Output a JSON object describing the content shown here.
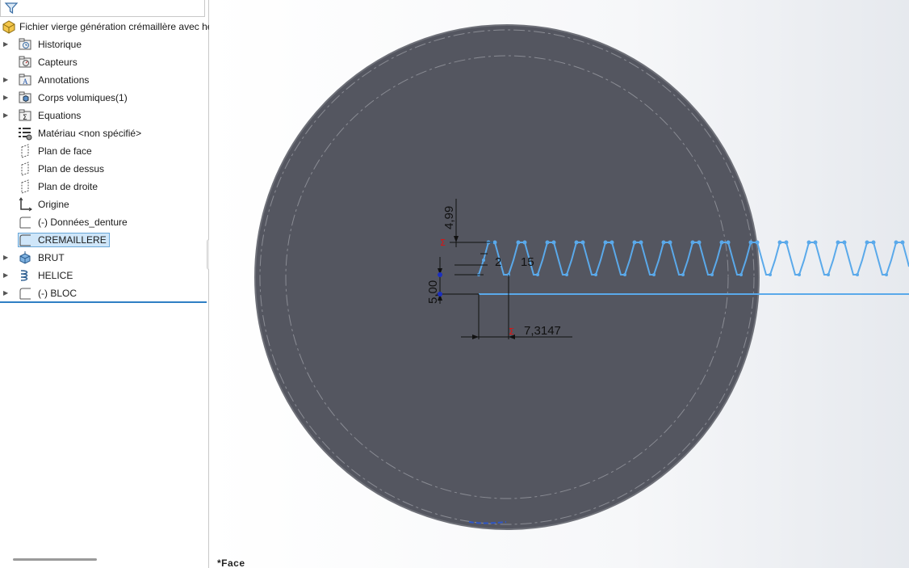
{
  "feature_tree": {
    "root_label": "Fichier vierge génération crémaillère avec hé",
    "items": [
      {
        "label": "Historique",
        "icon": "history-folder-icon",
        "expandable": true
      },
      {
        "label": "Capteurs",
        "icon": "sensors-icon",
        "expandable": false
      },
      {
        "label": "Annotations",
        "icon": "annotations-icon",
        "expandable": true
      },
      {
        "label": "Corps volumiques(1)",
        "icon": "solid-bodies-icon",
        "expandable": true
      },
      {
        "label": "Equations",
        "icon": "equations-icon",
        "expandable": true
      },
      {
        "label": "Matériau <non spécifié>",
        "icon": "material-icon",
        "expandable": false
      },
      {
        "label": "Plan de face",
        "icon": "plane-icon",
        "expandable": false
      },
      {
        "label": "Plan de dessus",
        "icon": "plane-icon",
        "expandable": false
      },
      {
        "label": "Plan de droite",
        "icon": "plane-icon",
        "expandable": false
      },
      {
        "label": "Origine",
        "icon": "origin-icon",
        "expandable": false
      },
      {
        "label": "(-) Données_denture",
        "icon": "sketch-icon",
        "expandable": false
      },
      {
        "label": "CREMAILLERE",
        "icon": "sketch-icon",
        "expandable": false,
        "selected": true
      },
      {
        "label": "BRUT",
        "icon": "extrude-icon",
        "expandable": true
      },
      {
        "label": "HELICE",
        "icon": "helix-icon",
        "expandable": true
      },
      {
        "label": "(-) BLOC",
        "icon": "sketch-icon",
        "expandable": true
      }
    ]
  },
  "viewport": {
    "view_name": "*Face",
    "dimensions": {
      "d1": "4,99",
      "d2": "2",
      "d3": "15",
      "d4": "5,00",
      "d5": "7,3147"
    }
  },
  "colors": {
    "part_fill": "#545660",
    "sketch_blue": "#5aa9ea",
    "selection_bg": "#cfe6f9",
    "tree_accent": "#2f7fc4"
  }
}
